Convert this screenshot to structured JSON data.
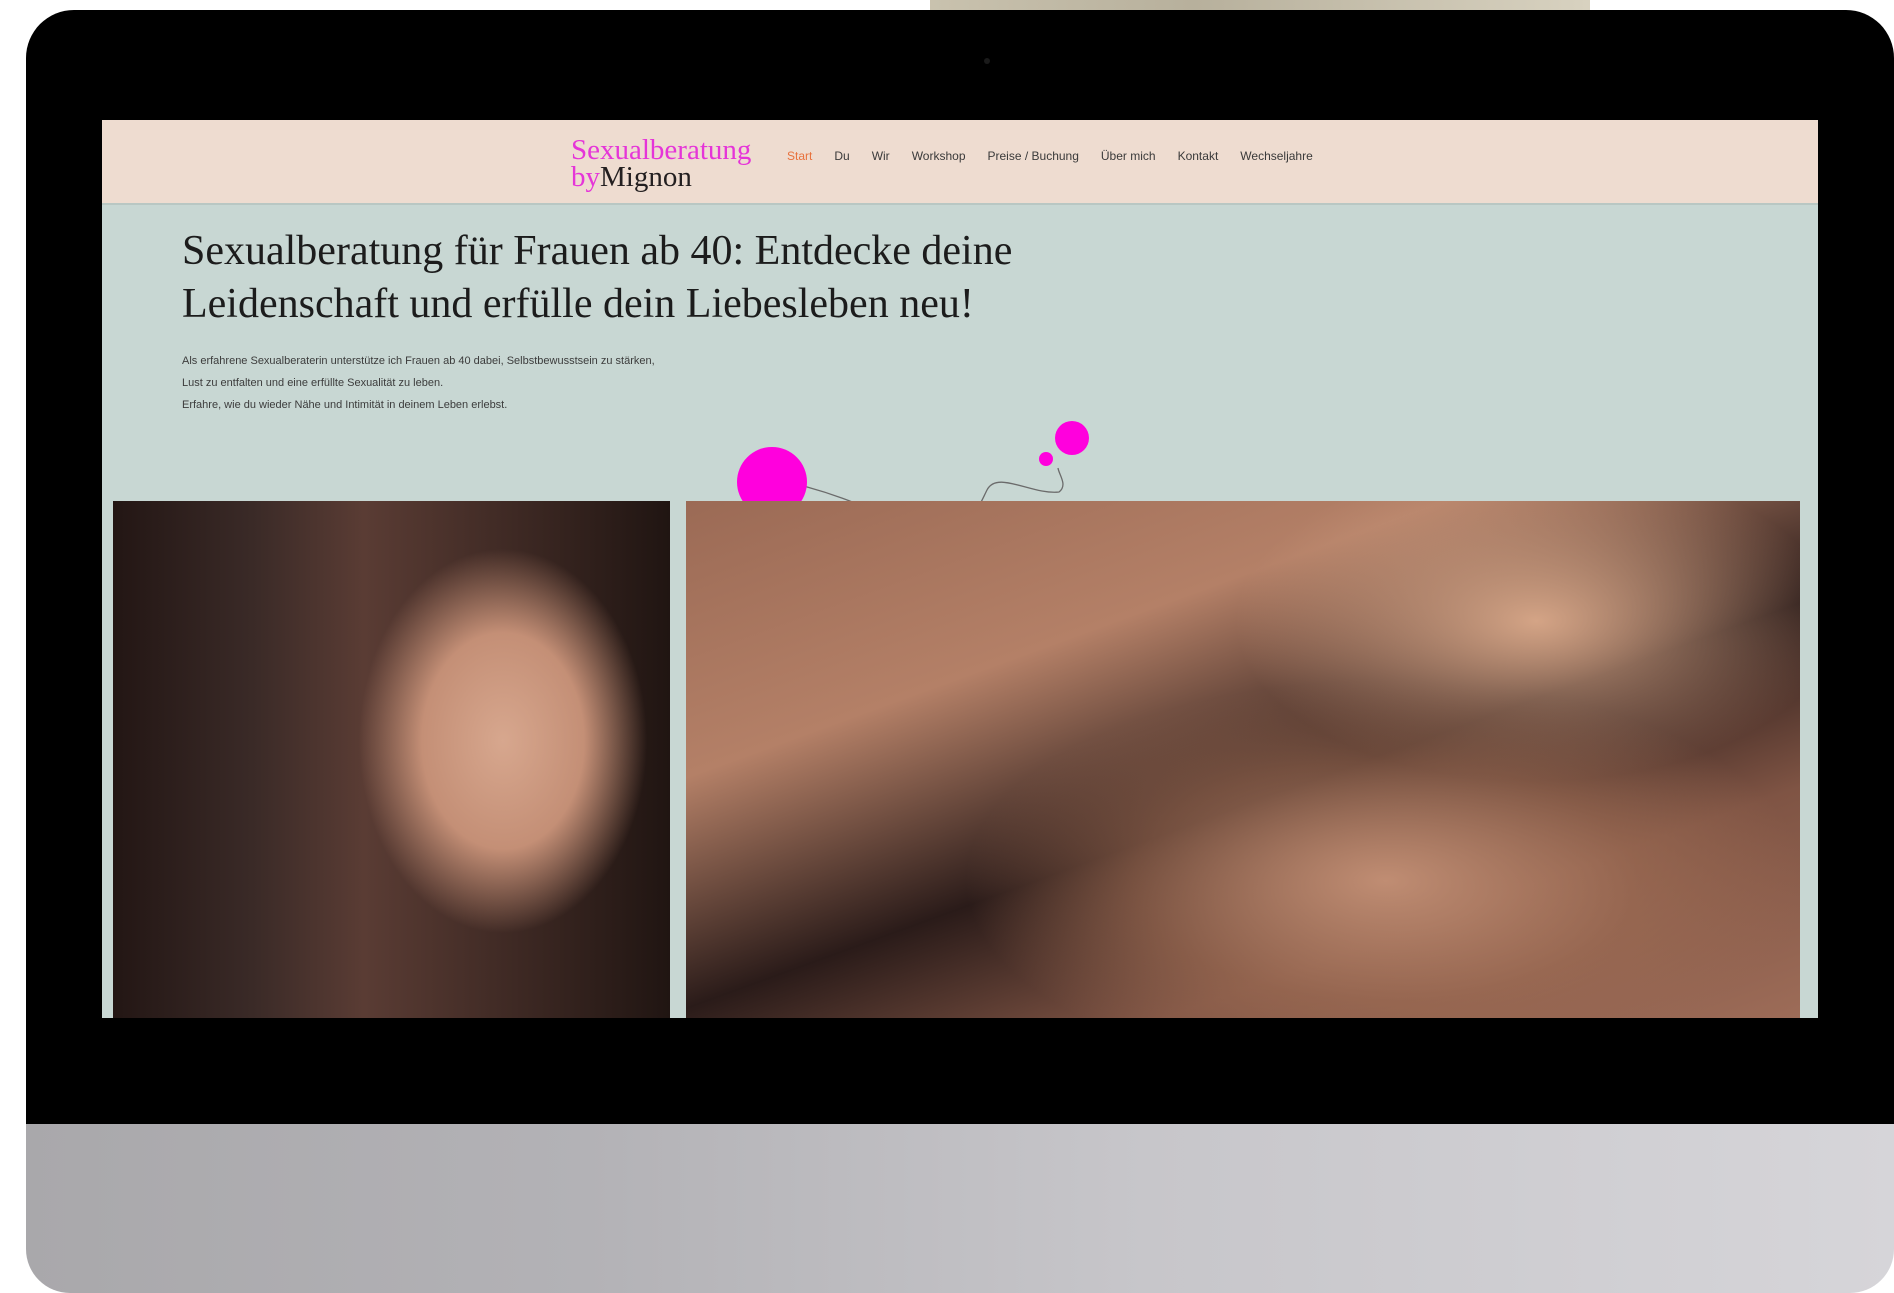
{
  "logo": {
    "line1": "Sexualberatung",
    "by": "by",
    "name": "Mignon"
  },
  "nav": {
    "items": [
      {
        "label": "Start",
        "active": true
      },
      {
        "label": "Du"
      },
      {
        "label": "Wir"
      },
      {
        "label": "Workshop"
      },
      {
        "label": "Preise / Buchung"
      },
      {
        "label": "Über mich"
      },
      {
        "label": "Kontakt"
      },
      {
        "label": "Wechseljahre"
      }
    ]
  },
  "hero": {
    "title_line1": "Sexualberatung für Frauen ab 40: Entdecke deine",
    "title_line2": "Leidenschaft und erfülle dein Liebesleben neu!",
    "text_line1": "Als erfahrene Sexualberaterin unterstütze ich Frauen ab 40 dabei, Selbstbewusstsein zu stärken,",
    "text_line2": "Lust zu entfalten und eine erfüllte Sexualität zu leben.",
    "text_line3": "Erfahre, wie du wieder Nähe und Intimität in deinem Leben erlebst."
  },
  "colors": {
    "brand_magenta": "#ff00dd",
    "nav_active": "#e8713c",
    "header_bg": "#eedcd0",
    "page_bg": "#c8d7d3"
  },
  "images": {
    "left": "woman-portrait-photo",
    "right": "couple-photo"
  }
}
